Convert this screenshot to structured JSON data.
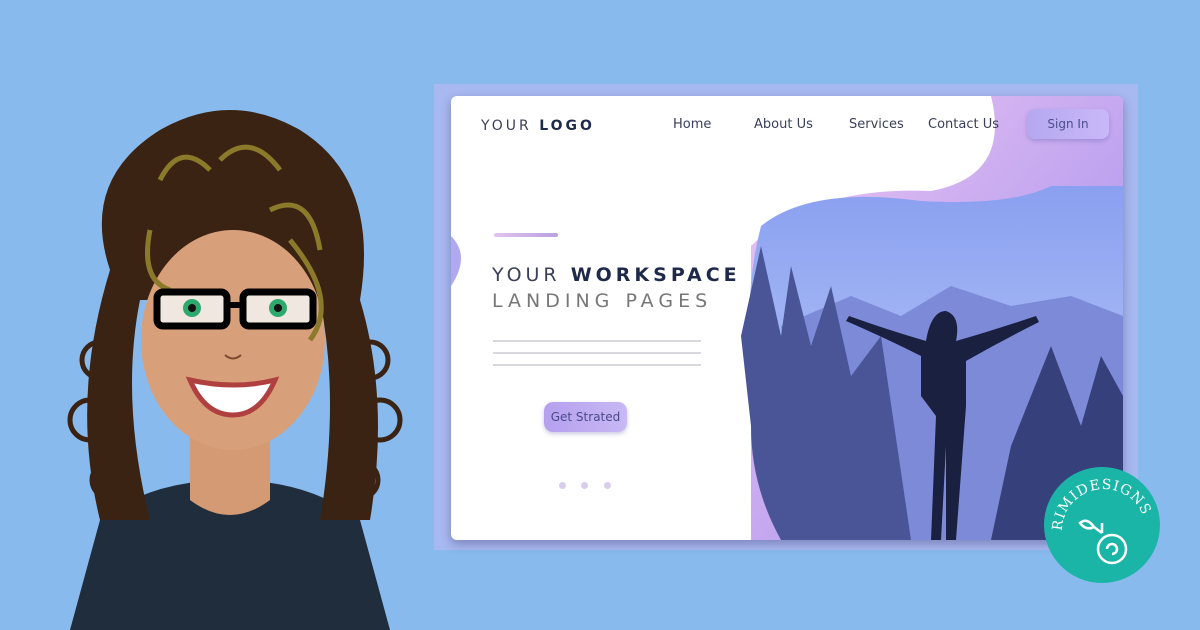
{
  "mockup": {
    "logo": {
      "prefix": "YOUR",
      "bold": "LOGO"
    },
    "nav": [
      {
        "label": "Home"
      },
      {
        "label": "About Us"
      },
      {
        "label": "Services"
      },
      {
        "label": "Contact Us"
      }
    ],
    "sign_in": "Sign In",
    "headline": {
      "prefix": "YOUR",
      "bold": "WORKSPACE",
      "line2": "LANDING PAGES"
    },
    "cta": "Get Strated",
    "carousel": {
      "dots": 3
    }
  },
  "badge": {
    "text": "RIMIDESIGNS",
    "color": "#1bb5a8"
  },
  "colors": {
    "background": "#88baee",
    "accent": "#b5a8f0",
    "hair": "#3b2314",
    "shirt": "#1f2d3d"
  }
}
